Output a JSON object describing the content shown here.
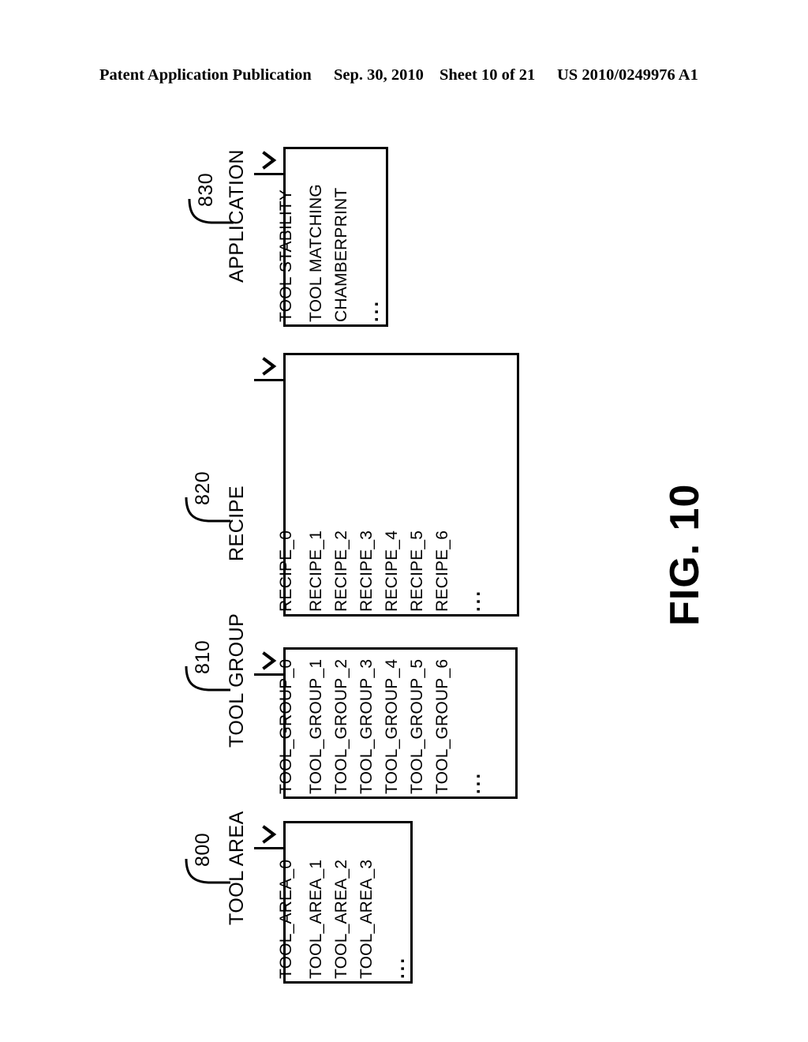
{
  "header": {
    "publication": "Patent Application Publication",
    "date": "Sep. 30, 2010",
    "sheet": "Sheet 10 of 21",
    "patent_number": "US 2010/0249976 A1"
  },
  "figure": {
    "title": "FIG. 10"
  },
  "widgets": [
    {
      "id": "application",
      "caption": "APPLICATION",
      "ref": "830",
      "selected": "TOOL STABILITY",
      "options": [
        "TOOL MATCHING",
        "CHAMBERPRINT"
      ],
      "ellipsis": "..."
    },
    {
      "id": "recipe",
      "caption": "RECIPE",
      "ref": "820",
      "selected": "RECIPE_0",
      "options": [
        "RECIPE_1",
        "RECIPE_2",
        "RECIPE_3",
        "RECIPE_4",
        "RECIPE_5",
        "RECIPE_6"
      ],
      "ellipsis": "..."
    },
    {
      "id": "tool-group",
      "caption": "TOOL GROUP",
      "ref": "810",
      "selected": "TOOL_GROUP_0",
      "options": [
        "TOOL_GROUP_1",
        "TOOL_GROUP_2",
        "TOOL_GROUP_3",
        "TOOL_GROUP_4",
        "TOOL_GROUP_5",
        "TOOL_GROUP_6"
      ],
      "ellipsis": "..."
    },
    {
      "id": "tool-area",
      "caption": "TOOL AREA",
      "ref": "800",
      "selected": "TOOL_AREA_0",
      "options": [
        "TOOL_AREA_1",
        "TOOL_AREA_2",
        "TOOL_AREA_3"
      ],
      "ellipsis": "..."
    }
  ],
  "icons": {
    "dropdown_chevron": "chevron-down-icon"
  },
  "colors": {
    "ink": "#000000",
    "paper": "#ffffff"
  }
}
